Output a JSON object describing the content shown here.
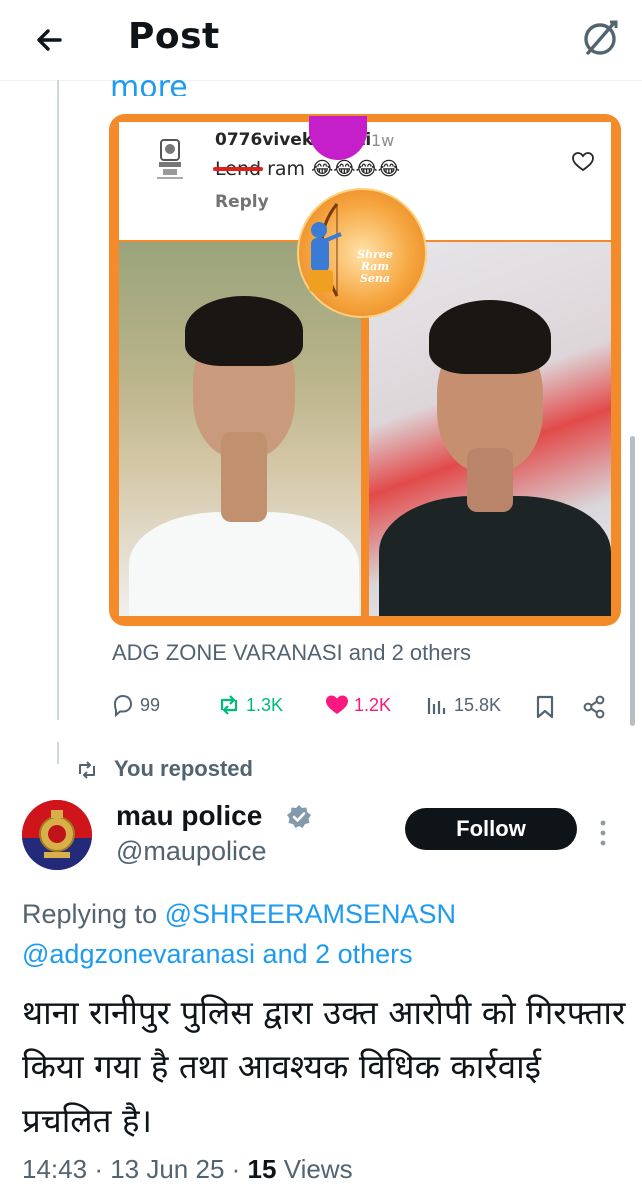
{
  "header": {
    "title": "Post"
  },
  "above": {
    "more_peek": "more"
  },
  "embedded_comment": {
    "username": "0776vivekbharti",
    "time": "1w",
    "text_struck": "Lend",
    "text_rest": " ram 😂😂😂😂",
    "reply_label": "Reply",
    "logo_text": "Shree Ram Sena"
  },
  "liked_by": "ADG ZONE VARANASI and 2 others",
  "actions": {
    "replies": "99",
    "reposts": "1.3K",
    "likes": "1.2K",
    "views": "15.8K"
  },
  "colors": {
    "accent": "#1d9bf0",
    "repost": "#00ba7c",
    "like": "#f91880",
    "card_border": "#f38b2b"
  },
  "reply_post": {
    "reposted_label": "You reposted",
    "display_name": "mau police",
    "handle": "@maupolice",
    "follow_label": "Follow",
    "replying_prefix": "Replying to ",
    "replying_to_1": "@SHREERAMSENASN",
    "replying_to_2": "@adgzonevaranasi and 2 others",
    "text": "थाना रानीपुर पुलिस द्वारा उक्त आरोपी को गिरफ्तार किया गया है तथा आवश्यक विधिक कार्रवाई प्रचलित है।",
    "time": "14:43",
    "date": "13 Jun 25",
    "views_count": "15",
    "views_label": "Views"
  }
}
